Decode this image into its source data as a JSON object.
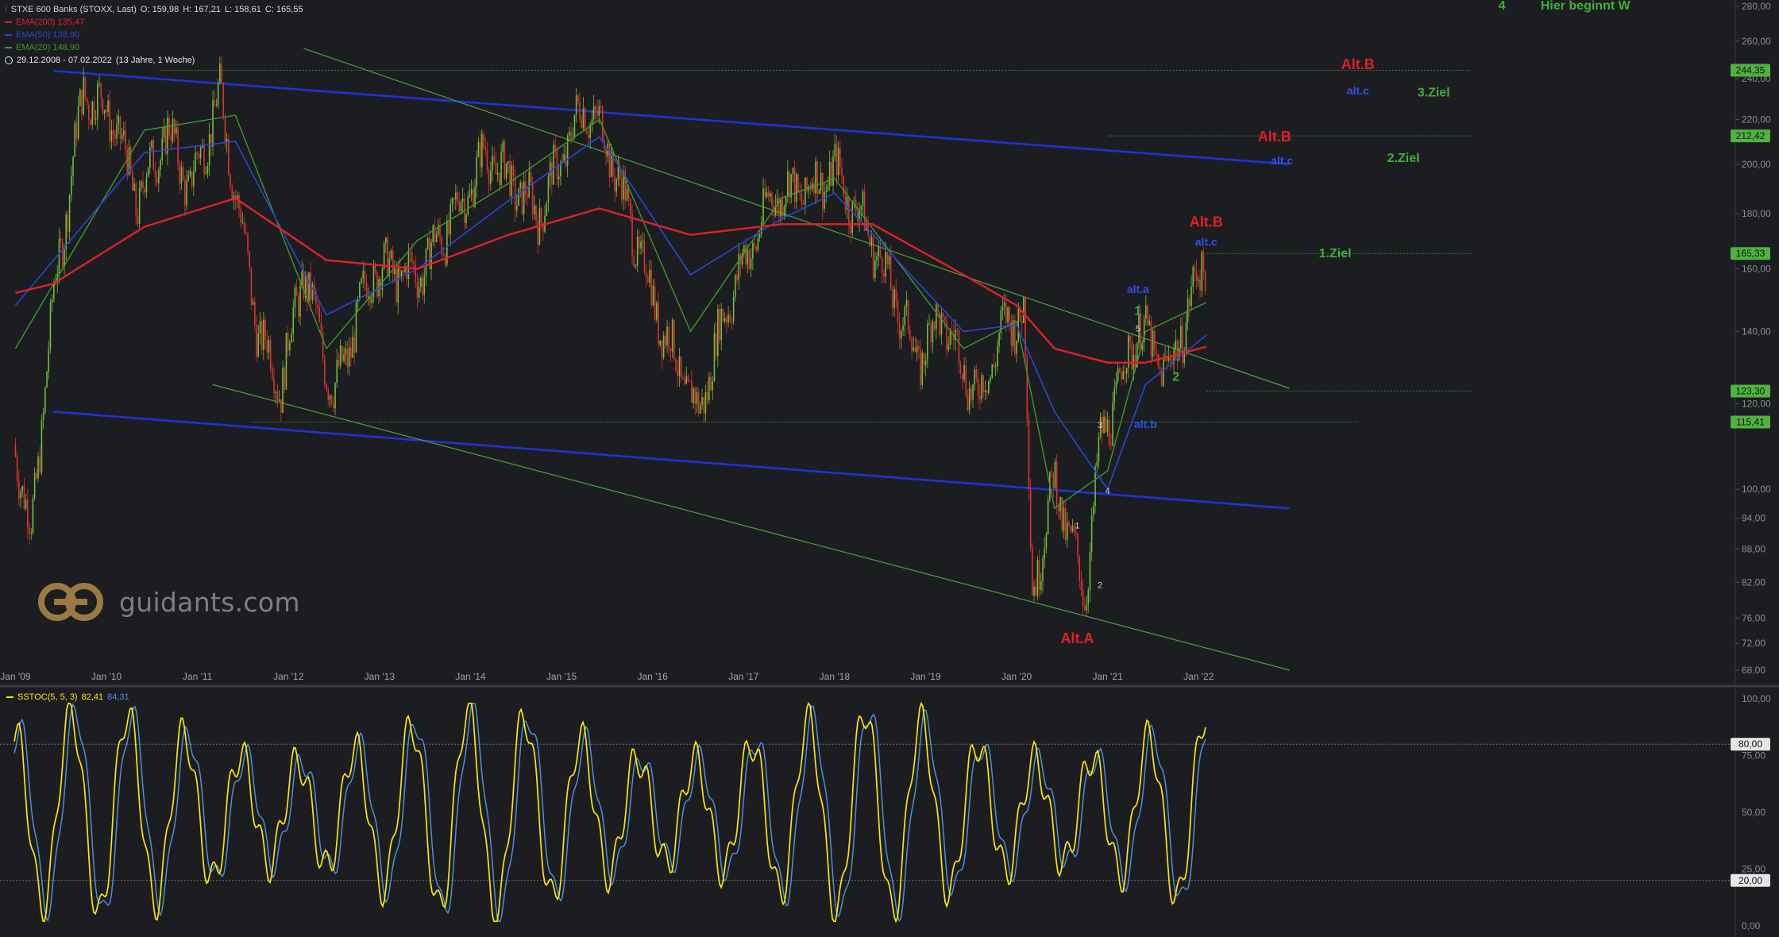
{
  "header": {
    "instrument": "STXE 600 Banks (STOXX, Last)",
    "o": "O: 159,98",
    "h": "H: 167,21",
    "l": "L: 158,61",
    "c": "C: 165,55",
    "ema200": "EMA(200)  135,47",
    "ema50": "EMA(50)  138,90",
    "ema20": "EMA(20)  148,90",
    "range": "29.12.2008 - 07.02.2022",
    "span": "(13 Jahre, 1 Woche)"
  },
  "stoch_legend": {
    "label": "SSTOC(5, 5, 3)",
    "k": "82,41",
    "d": "84,31"
  },
  "logo_text": "guidants.com",
  "colors": {
    "bg": "#1c1d21",
    "up": "#6fbf3a",
    "down": "#e0312d",
    "ema200": "#e0212a",
    "ema50": "#2a45d6",
    "ema20": "#3c9a2c",
    "channel": "#1e34d8",
    "green_line": "#4aa33a",
    "stoch_k": "#ffe600",
    "stoch_d": "#4a90d9",
    "label_red": "#e21f26",
    "label_blue": "#2e50e8",
    "label_green": "#3fae3a"
  },
  "chart_data": {
    "type": "candlestick",
    "scale": "log",
    "ylim": [
      68,
      280
    ],
    "x_ticks": [
      "Jan '09",
      "Jan '10",
      "Jan '11",
      "Jan '12",
      "Jan '13",
      "Jan '14",
      "Jan '15",
      "Jan '16",
      "Jan '17",
      "Jan '18",
      "Jan '19",
      "Jan '20",
      "Jan '21",
      "Jan '22"
    ],
    "y_ticks": [
      "280,00",
      "260,00",
      "240,00",
      "220,00",
      "200,00",
      "180,00",
      "160,00",
      "140,00",
      "120,00",
      "100,00",
      "94,00",
      "88,00",
      "82,00",
      "76,00",
      "72,00",
      "68,00"
    ],
    "price_path": [
      [
        "2009-01",
        110
      ],
      [
        "2009-03",
        90
      ],
      [
        "2009-06",
        150
      ],
      [
        "2009-10",
        235
      ],
      [
        "2010-02",
        220
      ],
      [
        "2010-05",
        185
      ],
      [
        "2010-09",
        215
      ],
      [
        "2010-12",
        190
      ],
      [
        "2011-04",
        232
      ],
      [
        "2011-09",
        140
      ],
      [
        "2011-12",
        125
      ],
      [
        "2012-03",
        160
      ],
      [
        "2012-07",
        122
      ],
      [
        "2012-12",
        160
      ],
      [
        "2013-06",
        158
      ],
      [
        "2013-12",
        185
      ],
      [
        "2014-03",
        205
      ],
      [
        "2014-10",
        180
      ],
      [
        "2015-04",
        228
      ],
      [
        "2015-07",
        210
      ],
      [
        "2016-02",
        143
      ],
      [
        "2016-07",
        117
      ],
      [
        "2016-11",
        150
      ],
      [
        "2017-05",
        188
      ],
      [
        "2017-10",
        190
      ],
      [
        "2018-01",
        198
      ],
      [
        "2018-06",
        170
      ],
      [
        "2018-12",
        132
      ],
      [
        "2019-03",
        145
      ],
      [
        "2019-08",
        121
      ],
      [
        "2019-11",
        140
      ],
      [
        "2020-02",
        147
      ],
      [
        "2020-03",
        80
      ],
      [
        "2020-06",
        102
      ],
      [
        "2020-10",
        80
      ],
      [
        "2020-12",
        110
      ],
      [
        "2021-05",
        142
      ],
      [
        "2021-09",
        128
      ],
      [
        "2021-12",
        150
      ],
      [
        "2022-02",
        165.55
      ]
    ],
    "ema200_path": [
      [
        "2009-01",
        152
      ],
      [
        "2009-06",
        155
      ],
      [
        "2010-06",
        175
      ],
      [
        "2011-06",
        186
      ],
      [
        "2012-06",
        163
      ],
      [
        "2013-06",
        160
      ],
      [
        "2014-06",
        172
      ],
      [
        "2015-06",
        182
      ],
      [
        "2016-06",
        172
      ],
      [
        "2017-06",
        176
      ],
      [
        "2018-06",
        176
      ],
      [
        "2019-06",
        158
      ],
      [
        "2020-01",
        148
      ],
      [
        "2020-06",
        135
      ],
      [
        "2021-01",
        131
      ],
      [
        "2021-06",
        131
      ],
      [
        "2022-02",
        135.47
      ]
    ],
    "ema50_path": [
      [
        "2009-01",
        148
      ],
      [
        "2010-06",
        205
      ],
      [
        "2011-06",
        210
      ],
      [
        "2012-06",
        145
      ],
      [
        "2013-06",
        160
      ],
      [
        "2014-06",
        185
      ],
      [
        "2015-06",
        212
      ],
      [
        "2016-06",
        158
      ],
      [
        "2017-06",
        178
      ],
      [
        "2018-01",
        188
      ],
      [
        "2019-06",
        140
      ],
      [
        "2020-01",
        142
      ],
      [
        "2020-06",
        118
      ],
      [
        "2021-01",
        100
      ],
      [
        "2021-06",
        125
      ],
      [
        "2022-02",
        138.9
      ]
    ],
    "ema20_path": [
      [
        "2009-01",
        135
      ],
      [
        "2010-06",
        215
      ],
      [
        "2011-06",
        222
      ],
      [
        "2012-06",
        135
      ],
      [
        "2013-06",
        170
      ],
      [
        "2014-06",
        192
      ],
      [
        "2015-06",
        220
      ],
      [
        "2016-06",
        140
      ],
      [
        "2017-06",
        186
      ],
      [
        "2018-01",
        194
      ],
      [
        "2019-06",
        135
      ],
      [
        "2020-01",
        143
      ],
      [
        "2020-06",
        96
      ],
      [
        "2021-01",
        104
      ],
      [
        "2021-06",
        140
      ],
      [
        "2022-02",
        148.9
      ]
    ],
    "price_tags": [
      {
        "value": 244.35,
        "label": "244,35"
      },
      {
        "value": 212.42,
        "label": "212,42"
      },
      {
        "value": 165.33,
        "label": "165,33"
      },
      {
        "value": 123.3,
        "label": "123,30"
      },
      {
        "value": 115.41,
        "label": "115,41"
      }
    ],
    "channel_lines": [
      {
        "from": [
          "2009-06",
          244
        ],
        "to": [
          "2023-01",
          200
        ]
      },
      {
        "from": [
          "2009-06",
          118
        ],
        "to": [
          "2023-01",
          96
        ]
      }
    ],
    "green_lines": [
      {
        "from": [
          "2012-03",
          256
        ],
        "to": [
          "2023-01",
          124
        ]
      },
      {
        "from": [
          "2011-03",
          125
        ],
        "to": [
          "2023-01",
          68
        ]
      }
    ],
    "horizontal_levels": [
      {
        "value": 244.35,
        "from": "2010-08",
        "to": "2025-01"
      },
      {
        "value": 212.42,
        "from": "2021-01",
        "to": "2025-01"
      },
      {
        "value": 165.33,
        "from": "2022-02",
        "to": "2025-01"
      },
      {
        "value": 123.3,
        "from": "2022-02",
        "to": "2025-01"
      },
      {
        "value": 115.41,
        "from": "2011-08",
        "to": "2023-10"
      }
    ],
    "annotations": [
      {
        "text": "Alt.B",
        "color": "red",
        "at": [
          "2023-10",
          245
        ],
        "size": "big"
      },
      {
        "text": "alt.c",
        "color": "blue",
        "at": [
          "2023-10",
          232
        ],
        "size": "small"
      },
      {
        "text": "3.Ziel",
        "color": "green",
        "at": [
          "2024-08",
          231
        ],
        "size": "mid"
      },
      {
        "text": "Alt.B",
        "color": "red",
        "at": [
          "2022-11",
          210
        ],
        "size": "big"
      },
      {
        "text": "alt.c",
        "color": "blue",
        "at": [
          "2022-12",
          200
        ],
        "size": "small"
      },
      {
        "text": "2.Ziel",
        "color": "green",
        "at": [
          "2024-04",
          201
        ],
        "size": "mid"
      },
      {
        "text": "Alt.B",
        "color": "red",
        "at": [
          "2022-02",
          175
        ],
        "size": "big"
      },
      {
        "text": "alt.c",
        "color": "blue",
        "at": [
          "2022-02",
          168
        ],
        "size": "small"
      },
      {
        "text": "1.Ziel",
        "color": "green",
        "at": [
          "2023-07",
          164
        ],
        "size": "mid"
      },
      {
        "text": "alt.a",
        "color": "blue",
        "at": [
          "2021-05",
          152
        ],
        "size": "small"
      },
      {
        "text": "1",
        "color": "green",
        "at": [
          "2021-05",
          145
        ],
        "size": "mid"
      },
      {
        "text": "2",
        "color": "green",
        "at": [
          "2021-10",
          126
        ],
        "size": "mid"
      },
      {
        "text": "alt.b",
        "color": "blue",
        "at": [
          "2021-06",
          114
        ],
        "size": "small"
      },
      {
        "text": "Alt.A",
        "color": "red",
        "at": [
          "2020-09",
          72
        ],
        "size": "big"
      },
      {
        "text": "4",
        "color": "green",
        "at": [
          "2025-05",
          300
        ],
        "size": "mid"
      },
      {
        "text": "Hier beginnt W",
        "color": "green",
        "at": [
          "2026-04",
          296
        ],
        "size": "mid"
      }
    ],
    "wave_counts": [
      {
        "text": "5",
        "at": [
          "2021-05",
          140
        ]
      },
      {
        "text": "3",
        "at": [
          "2020-12",
          114
        ]
      },
      {
        "text": "4",
        "at": [
          "2021-01",
          99
        ]
      },
      {
        "text": "1",
        "at": [
          "2020-09",
          92
        ]
      },
      {
        "text": "2",
        "at": [
          "2020-12",
          81
        ]
      }
    ],
    "stochastic": {
      "name": "SSTOC(5, 5, 3)",
      "k_last": 82.41,
      "d_last": 84.31,
      "ylim": [
        0,
        100
      ],
      "levels": [
        20,
        80
      ],
      "y_ticks": [
        "100,00",
        "75,00",
        "50,00",
        "25,00",
        "0,00"
      ],
      "level_tags": [
        "80,00",
        "20,00"
      ]
    }
  }
}
